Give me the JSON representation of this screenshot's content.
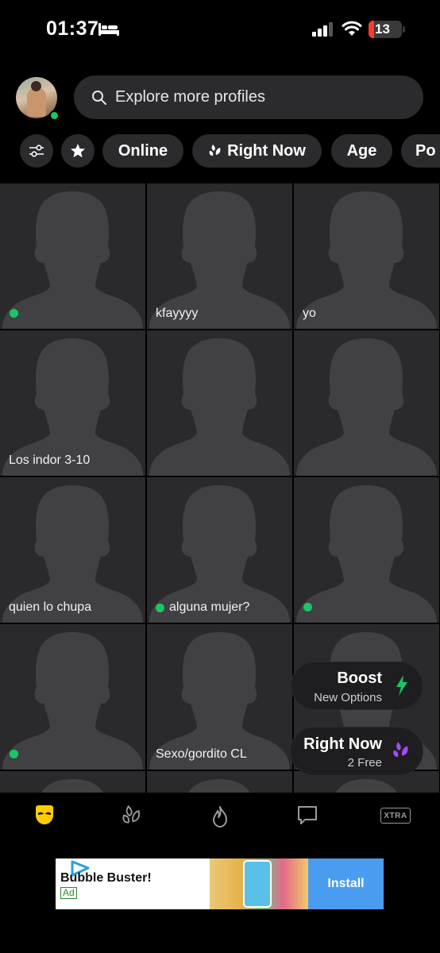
{
  "status_bar": {
    "time": "01:37",
    "battery": "13"
  },
  "header": {
    "search_placeholder": "Explore more profiles"
  },
  "filters": [
    "Online",
    "Right Now",
    "Age",
    "Po"
  ],
  "grid": [
    {
      "name": "",
      "online": true
    },
    {
      "name": "kfayyyy",
      "online": false
    },
    {
      "name": "yo",
      "online": false
    },
    {
      "name": "Los indor 3-10",
      "online": false
    },
    {
      "name": "",
      "online": false
    },
    {
      "name": "",
      "online": false
    },
    {
      "name": "quien lo chupa",
      "online": false
    },
    {
      "name": "alguna mujer?",
      "online": true
    },
    {
      "name": "",
      "online": true
    },
    {
      "name": "",
      "online": true
    },
    {
      "name": "Sexo/gordito CL",
      "online": false
    },
    {
      "name": "",
      "online": false
    }
  ],
  "boost": {
    "title": "Boost",
    "subtitle": "New Options"
  },
  "right_now": {
    "title": "Right Now",
    "subtitle": "2 Free"
  },
  "tabbar": {
    "xtra": "XTRA"
  },
  "ad": {
    "title": "Bubble Buster!",
    "badge": "Ad",
    "cta": "Install"
  },
  "colors": {
    "online": "#17c964",
    "boost": "#17c964",
    "right_now": "#a64bf4",
    "accent": "#ffcc00"
  }
}
